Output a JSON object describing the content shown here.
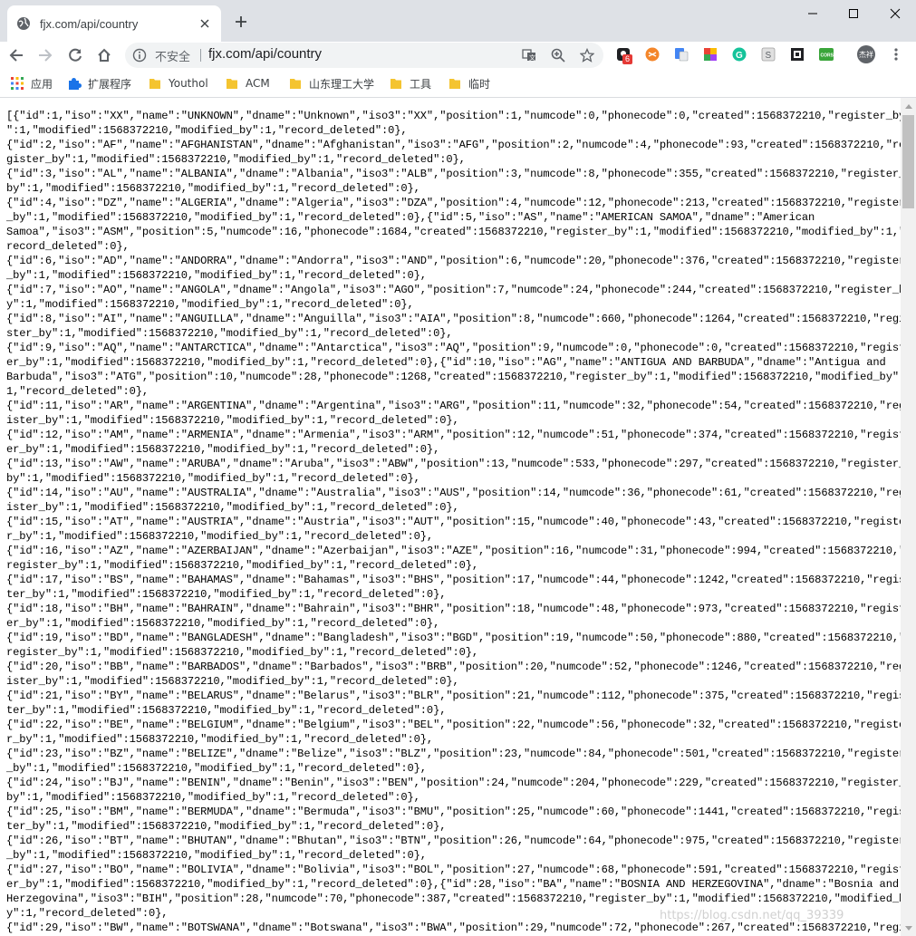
{
  "tab": {
    "title": "fjx.com/api/country",
    "close_label": "×",
    "new_tab_label": "+"
  },
  "window_controls": {
    "minimize": "—",
    "maximize": "☐",
    "close": "✕"
  },
  "toolbar": {
    "security_label": "不安全",
    "url": "fjx.com/api/country",
    "extension_badge": "6",
    "avatar_text": "杰祥"
  },
  "bookmarks": [
    {
      "label": "应用",
      "icon": "apps-grid-icon"
    },
    {
      "label": "扩展程序",
      "icon": "puzzle-icon"
    },
    {
      "label": "Youthol",
      "icon": "folder-icon"
    },
    {
      "label": "ACM",
      "icon": "folder-icon"
    },
    {
      "label": "山东理工大学",
      "icon": "folder-icon"
    },
    {
      "label": "工具",
      "icon": "folder-icon"
    },
    {
      "label": "临时",
      "icon": "folder-icon"
    }
  ],
  "colors": {
    "tabstrip": "#dee1e6",
    "omnibox": "#f1f3f4",
    "folder": "#f4c430",
    "puzzle": "#1a73e8"
  },
  "json_lines": [
    "[{\"id\":1,\"iso\":\"XX\",\"name\":\"UNKNOWN\",\"dname\":\"Unknown\",\"iso3\":\"XX\",\"position\":1,\"numcode\":0,\"phonecode\":0,\"created\":1568372210,\"register_by",
    "\":1,\"modified\":1568372210,\"modified_by\":1,\"record_deleted\":0},",
    "{\"id\":2,\"iso\":\"AF\",\"name\":\"AFGHANISTAN\",\"dname\":\"Afghanistan\",\"iso3\":\"AFG\",\"position\":2,\"numcode\":4,\"phonecode\":93,\"created\":1568372210,\"re",
    "gister_by\":1,\"modified\":1568372210,\"modified_by\":1,\"record_deleted\":0},",
    "{\"id\":3,\"iso\":\"AL\",\"name\":\"ALBANIA\",\"dname\":\"Albania\",\"iso3\":\"ALB\",\"position\":3,\"numcode\":8,\"phonecode\":355,\"created\":1568372210,\"register_",
    "by\":1,\"modified\":1568372210,\"modified_by\":1,\"record_deleted\":0},",
    "{\"id\":4,\"iso\":\"DZ\",\"name\":\"ALGERIA\",\"dname\":\"Algeria\",\"iso3\":\"DZA\",\"position\":4,\"numcode\":12,\"phonecode\":213,\"created\":1568372210,\"register",
    "_by\":1,\"modified\":1568372210,\"modified_by\":1,\"record_deleted\":0},{\"id\":5,\"iso\":\"AS\",\"name\":\"AMERICAN SAMOA\",\"dname\":\"American",
    "Samoa\",\"iso3\":\"ASM\",\"position\":5,\"numcode\":16,\"phonecode\":1684,\"created\":1568372210,\"register_by\":1,\"modified\":1568372210,\"modified_by\":1,\"",
    "record_deleted\":0},",
    "{\"id\":6,\"iso\":\"AD\",\"name\":\"ANDORRA\",\"dname\":\"Andorra\",\"iso3\":\"AND\",\"position\":6,\"numcode\":20,\"phonecode\":376,\"created\":1568372210,\"register",
    "_by\":1,\"modified\":1568372210,\"modified_by\":1,\"record_deleted\":0},",
    "{\"id\":7,\"iso\":\"AO\",\"name\":\"ANGOLA\",\"dname\":\"Angola\",\"iso3\":\"AGO\",\"position\":7,\"numcode\":24,\"phonecode\":244,\"created\":1568372210,\"register_b",
    "y\":1,\"modified\":1568372210,\"modified_by\":1,\"record_deleted\":0},",
    "{\"id\":8,\"iso\":\"AI\",\"name\":\"ANGUILLA\",\"dname\":\"Anguilla\",\"iso3\":\"AIA\",\"position\":8,\"numcode\":660,\"phonecode\":1264,\"created\":1568372210,\"regi",
    "ster_by\":1,\"modified\":1568372210,\"modified_by\":1,\"record_deleted\":0},",
    "{\"id\":9,\"iso\":\"AQ\",\"name\":\"ANTARCTICA\",\"dname\":\"Antarctica\",\"iso3\":\"AQ\",\"position\":9,\"numcode\":0,\"phonecode\":0,\"created\":1568372210,\"regist",
    "er_by\":1,\"modified\":1568372210,\"modified_by\":1,\"record_deleted\":0},{\"id\":10,\"iso\":\"AG\",\"name\":\"ANTIGUA AND BARBUDA\",\"dname\":\"Antigua and",
    "Barbuda\",\"iso3\":\"ATG\",\"position\":10,\"numcode\":28,\"phonecode\":1268,\"created\":1568372210,\"register_by\":1,\"modified\":1568372210,\"modified_by\":",
    "1,\"record_deleted\":0},",
    "{\"id\":11,\"iso\":\"AR\",\"name\":\"ARGENTINA\",\"dname\":\"Argentina\",\"iso3\":\"ARG\",\"position\":11,\"numcode\":32,\"phonecode\":54,\"created\":1568372210,\"reg",
    "ister_by\":1,\"modified\":1568372210,\"modified_by\":1,\"record_deleted\":0},",
    "{\"id\":12,\"iso\":\"AM\",\"name\":\"ARMENIA\",\"dname\":\"Armenia\",\"iso3\":\"ARM\",\"position\":12,\"numcode\":51,\"phonecode\":374,\"created\":1568372210,\"regist",
    "er_by\":1,\"modified\":1568372210,\"modified_by\":1,\"record_deleted\":0},",
    "{\"id\":13,\"iso\":\"AW\",\"name\":\"ARUBA\",\"dname\":\"Aruba\",\"iso3\":\"ABW\",\"position\":13,\"numcode\":533,\"phonecode\":297,\"created\":1568372210,\"register_",
    "by\":1,\"modified\":1568372210,\"modified_by\":1,\"record_deleted\":0},",
    "{\"id\":14,\"iso\":\"AU\",\"name\":\"AUSTRALIA\",\"dname\":\"Australia\",\"iso3\":\"AUS\",\"position\":14,\"numcode\":36,\"phonecode\":61,\"created\":1568372210,\"reg",
    "ister_by\":1,\"modified\":1568372210,\"modified_by\":1,\"record_deleted\":0},",
    "{\"id\":15,\"iso\":\"AT\",\"name\":\"AUSTRIA\",\"dname\":\"Austria\",\"iso3\":\"AUT\",\"position\":15,\"numcode\":40,\"phonecode\":43,\"created\":1568372210,\"registe",
    "r_by\":1,\"modified\":1568372210,\"modified_by\":1,\"record_deleted\":0},",
    "{\"id\":16,\"iso\":\"AZ\",\"name\":\"AZERBAIJAN\",\"dname\":\"Azerbaijan\",\"iso3\":\"AZE\",\"position\":16,\"numcode\":31,\"phonecode\":994,\"created\":1568372210,\"",
    "register_by\":1,\"modified\":1568372210,\"modified_by\":1,\"record_deleted\":0},",
    "{\"id\":17,\"iso\":\"BS\",\"name\":\"BAHAMAS\",\"dname\":\"Bahamas\",\"iso3\":\"BHS\",\"position\":17,\"numcode\":44,\"phonecode\":1242,\"created\":1568372210,\"regis",
    "ter_by\":1,\"modified\":1568372210,\"modified_by\":1,\"record_deleted\":0},",
    "{\"id\":18,\"iso\":\"BH\",\"name\":\"BAHRAIN\",\"dname\":\"Bahrain\",\"iso3\":\"BHR\",\"position\":18,\"numcode\":48,\"phonecode\":973,\"created\":1568372210,\"regist",
    "er_by\":1,\"modified\":1568372210,\"modified_by\":1,\"record_deleted\":0},",
    "{\"id\":19,\"iso\":\"BD\",\"name\":\"BANGLADESH\",\"dname\":\"Bangladesh\",\"iso3\":\"BGD\",\"position\":19,\"numcode\":50,\"phonecode\":880,\"created\":1568372210,\"",
    "register_by\":1,\"modified\":1568372210,\"modified_by\":1,\"record_deleted\":0},",
    "{\"id\":20,\"iso\":\"BB\",\"name\":\"BARBADOS\",\"dname\":\"Barbados\",\"iso3\":\"BRB\",\"position\":20,\"numcode\":52,\"phonecode\":1246,\"created\":1568372210,\"reg",
    "ister_by\":1,\"modified\":1568372210,\"modified_by\":1,\"record_deleted\":0},",
    "{\"id\":21,\"iso\":\"BY\",\"name\":\"BELARUS\",\"dname\":\"Belarus\",\"iso3\":\"BLR\",\"position\":21,\"numcode\":112,\"phonecode\":375,\"created\":1568372210,\"regis",
    "ter_by\":1,\"modified\":1568372210,\"modified_by\":1,\"record_deleted\":0},",
    "{\"id\":22,\"iso\":\"BE\",\"name\":\"BELGIUM\",\"dname\":\"Belgium\",\"iso3\":\"BEL\",\"position\":22,\"numcode\":56,\"phonecode\":32,\"created\":1568372210,\"registe",
    "r_by\":1,\"modified\":1568372210,\"modified_by\":1,\"record_deleted\":0},",
    "{\"id\":23,\"iso\":\"BZ\",\"name\":\"BELIZE\",\"dname\":\"Belize\",\"iso3\":\"BLZ\",\"position\":23,\"numcode\":84,\"phonecode\":501,\"created\":1568372210,\"register",
    "_by\":1,\"modified\":1568372210,\"modified_by\":1,\"record_deleted\":0},",
    "{\"id\":24,\"iso\":\"BJ\",\"name\":\"BENIN\",\"dname\":\"Benin\",\"iso3\":\"BEN\",\"position\":24,\"numcode\":204,\"phonecode\":229,\"created\":1568372210,\"register_",
    "by\":1,\"modified\":1568372210,\"modified_by\":1,\"record_deleted\":0},",
    "{\"id\":25,\"iso\":\"BM\",\"name\":\"BERMUDA\",\"dname\":\"Bermuda\",\"iso3\":\"BMU\",\"position\":25,\"numcode\":60,\"phonecode\":1441,\"created\":1568372210,\"regis",
    "ter_by\":1,\"modified\":1568372210,\"modified_by\":1,\"record_deleted\":0},",
    "{\"id\":26,\"iso\":\"BT\",\"name\":\"BHUTAN\",\"dname\":\"Bhutan\",\"iso3\":\"BTN\",\"position\":26,\"numcode\":64,\"phonecode\":975,\"created\":1568372210,\"register",
    "_by\":1,\"modified\":1568372210,\"modified_by\":1,\"record_deleted\":0},",
    "{\"id\":27,\"iso\":\"BO\",\"name\":\"BOLIVIA\",\"dname\":\"Bolivia\",\"iso3\":\"BOL\",\"position\":27,\"numcode\":68,\"phonecode\":591,\"created\":1568372210,\"regist",
    "er_by\":1,\"modified\":1568372210,\"modified_by\":1,\"record_deleted\":0},{\"id\":28,\"iso\":\"BA\",\"name\":\"BOSNIA AND HERZEGOVINA\",\"dname\":\"Bosnia and",
    "Herzegovina\",\"iso3\":\"BIH\",\"position\":28,\"numcode\":70,\"phonecode\":387,\"created\":1568372210,\"register_by\":1,\"modified\":1568372210,\"modified_b",
    "y\":1,\"record_deleted\":0},",
    "{\"id\":29,\"iso\":\"BW\",\"name\":\"BOTSWANA\",\"dname\":\"Botswana\",\"iso3\":\"BWA\",\"position\":29,\"numcode\":72,\"phonecode\":267,\"created\":1568372210,\"regi"
  ],
  "watermark": "https://blog.csdn.net/qq_39339"
}
